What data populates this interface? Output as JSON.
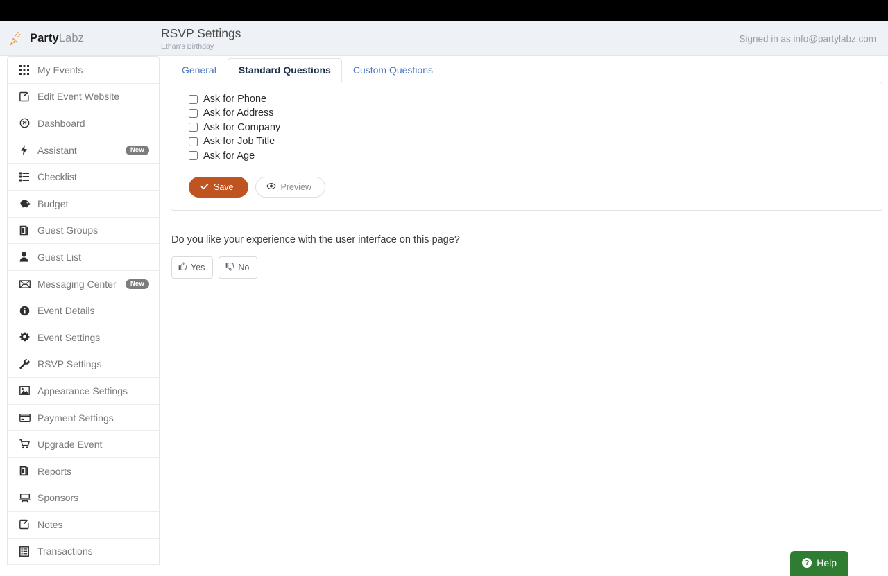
{
  "header": {
    "brand_bold": "Party",
    "brand_light": "Labz",
    "brand_icon": "party-popper-icon",
    "title": "RSVP Settings",
    "subtitle": "Ethan's Birthday",
    "signed_in": "Signed in as info@partylabz.com"
  },
  "sidebar": {
    "items": [
      {
        "label": "My Events",
        "icon": "grid-icon",
        "badge": null
      },
      {
        "label": "Edit Event Website",
        "icon": "edit-square-icon",
        "badge": null
      },
      {
        "label": "Dashboard",
        "icon": "gauge-icon",
        "badge": null
      },
      {
        "label": "Assistant",
        "icon": "lightning-bolt-icon",
        "badge": "New"
      },
      {
        "label": "Checklist",
        "icon": "list-icon",
        "badge": null
      },
      {
        "label": "Budget",
        "icon": "piggy-bank-icon",
        "badge": null
      },
      {
        "label": "Guest Groups",
        "icon": "book-icon",
        "badge": null
      },
      {
        "label": "Guest List",
        "icon": "person-icon",
        "badge": null
      },
      {
        "label": "Messaging Center",
        "icon": "envelope-icon",
        "badge": "New"
      },
      {
        "label": "Event Details",
        "icon": "info-circle-icon",
        "badge": null
      },
      {
        "label": "Event Settings",
        "icon": "gear-icon",
        "badge": null
      },
      {
        "label": "RSVP Settings",
        "icon": "wrench-icon",
        "badge": null
      },
      {
        "label": "Appearance Settings",
        "icon": "image-icon",
        "badge": null
      },
      {
        "label": "Payment Settings",
        "icon": "credit-card-icon",
        "badge": null
      },
      {
        "label": "Upgrade Event",
        "icon": "shopping-cart-icon",
        "badge": null
      },
      {
        "label": "Reports",
        "icon": "book-icon",
        "badge": null
      },
      {
        "label": "Sponsors",
        "icon": "projector-screen-icon",
        "badge": null
      },
      {
        "label": "Notes",
        "icon": "edit-square-icon",
        "badge": null
      },
      {
        "label": "Transactions",
        "icon": "list-alt-icon",
        "badge": null
      }
    ]
  },
  "main": {
    "tabs": [
      {
        "label": "General",
        "active": false
      },
      {
        "label": "Standard Questions",
        "active": true
      },
      {
        "label": "Custom Questions",
        "active": false
      }
    ],
    "questions": [
      {
        "label": "Ask for Phone",
        "checked": false
      },
      {
        "label": "Ask for Address",
        "checked": false
      },
      {
        "label": "Ask for Company",
        "checked": false
      },
      {
        "label": "Ask for Job Title",
        "checked": false
      },
      {
        "label": "Ask for Age",
        "checked": false
      }
    ],
    "save_label": "Save",
    "save_icon": "check-icon",
    "preview_label": "Preview",
    "preview_icon": "eye-icon",
    "feedback": {
      "question": "Do you like your experience with the user interface on this page?",
      "yes_label": "Yes",
      "yes_icon": "thumbs-up-icon",
      "no_label": "No",
      "no_icon": "thumbs-down-icon"
    }
  },
  "help": {
    "label": "Help",
    "icon": "question-circle-icon"
  },
  "colors": {
    "topbar": "#000000",
    "header_bg": "#eef1f6",
    "accent_save": "#bf5420",
    "tab_link": "#4b77be",
    "tab_active_text": "#1c2e4a",
    "badge_new": "#7c7c7c",
    "help_green": "#2e7d32"
  }
}
